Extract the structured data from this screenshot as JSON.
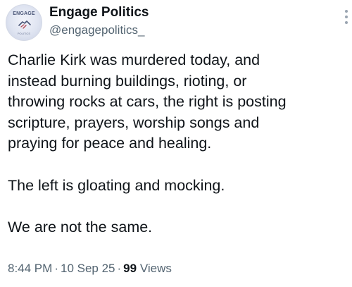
{
  "author": {
    "display_name": "Engage Politics",
    "handle": "@engagepolitics_",
    "avatar": {
      "top_text": "ENGAGE",
      "bottom_text": "POLITICS",
      "icon": "handshake-logo-icon"
    }
  },
  "tweet": {
    "lines": [
      "Charlie Kirk was murdered today, and",
      "instead burning buildings, rioting, or",
      "throwing rocks at cars, the right is posting",
      "scripture, prayers, worship songs and",
      "praying for peace and healing.",
      "The left is gloating and mocking.",
      "We are not the same."
    ]
  },
  "meta": {
    "time": "8:44 PM",
    "separator": "·",
    "date": "10 Sep 25",
    "views_count": "99",
    "views_label": "Views"
  },
  "colors": {
    "text_primary": "#0f1419",
    "text_secondary": "#536471",
    "background": "#ffffff"
  }
}
